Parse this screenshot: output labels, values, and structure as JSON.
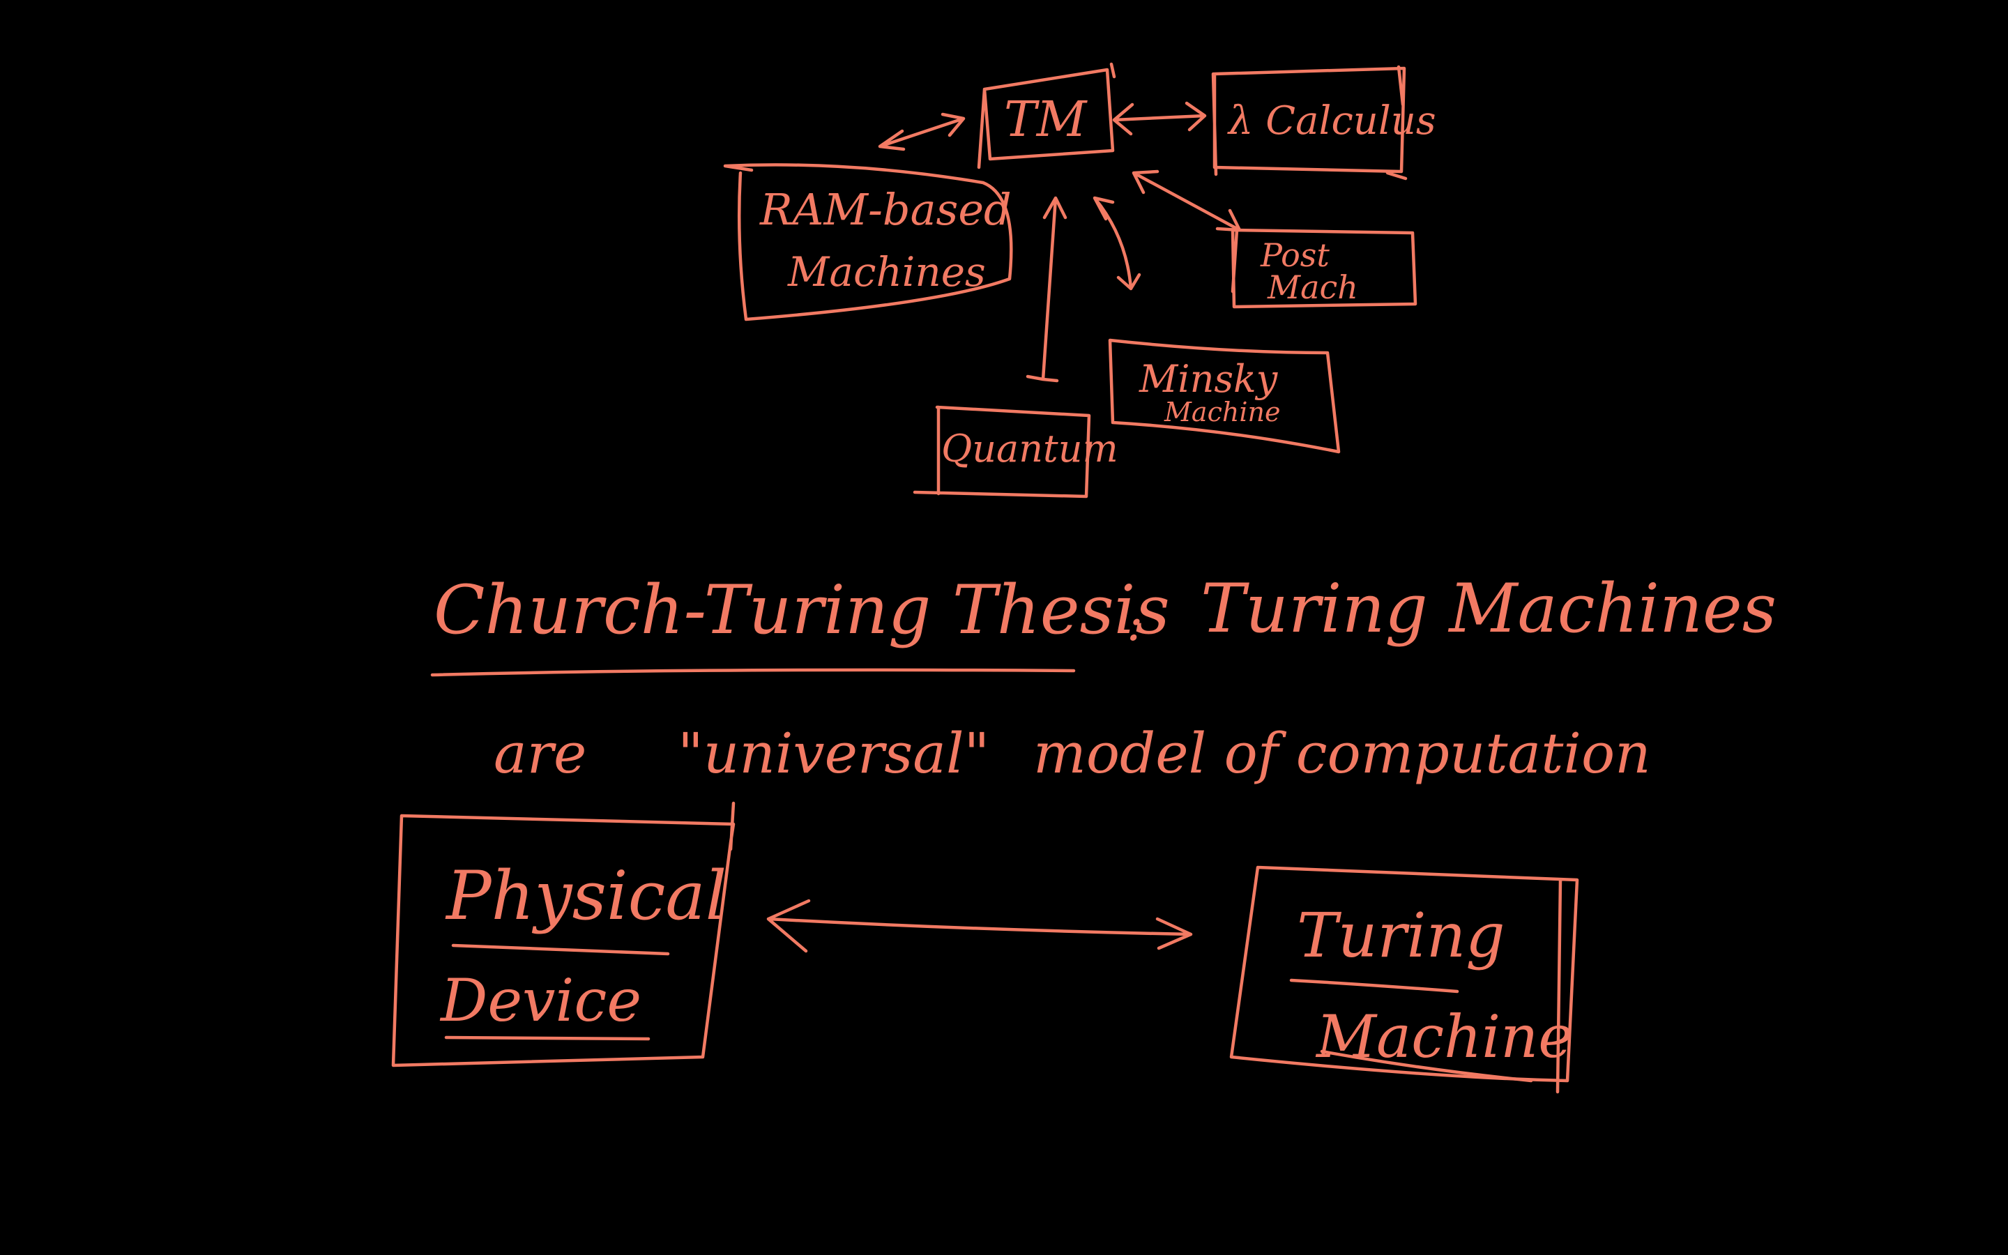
{
  "colors": {
    "background": "#000000",
    "ink": "#F27A63"
  },
  "models": {
    "tm": "TM",
    "lambda": "λ Calculus",
    "ram_line1": "RAM-based",
    "ram_line2": "Machines",
    "post_line1": "Post",
    "post_line2": "Mach",
    "minsky_line1": "Minsky",
    "minsky_line2": "Machine",
    "quantum": "Quantum"
  },
  "thesis": {
    "title": "Church-Turing Thesis",
    "colon": ":",
    "line1": "Turing Machines",
    "line2_are": "are",
    "line2_universal": "\"universal\"",
    "line2_rest": "model of computation"
  },
  "equivalence": {
    "left_line1": "Physical",
    "left_line2": "Device",
    "right_line1": "Turing",
    "right_line2": "Machine"
  }
}
